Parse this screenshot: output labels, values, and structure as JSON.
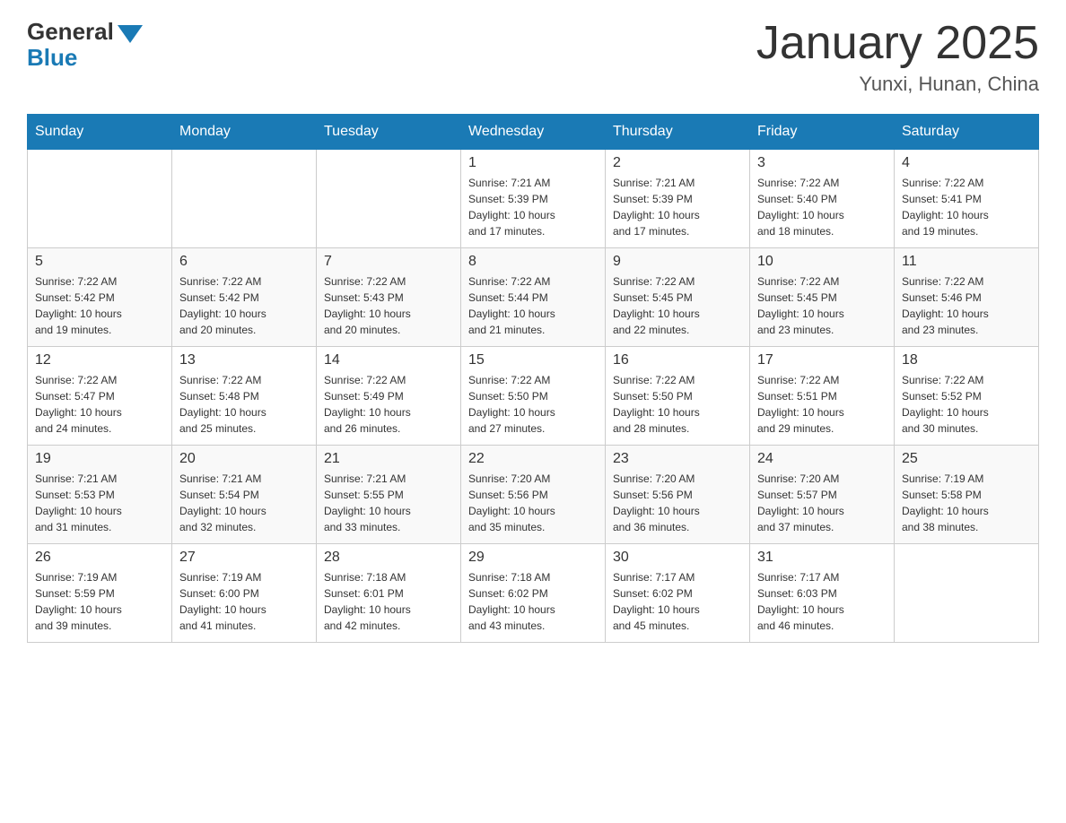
{
  "logo": {
    "general": "General",
    "blue": "Blue"
  },
  "title": "January 2025",
  "subtitle": "Yunxi, Hunan, China",
  "days_of_week": [
    "Sunday",
    "Monday",
    "Tuesday",
    "Wednesday",
    "Thursday",
    "Friday",
    "Saturday"
  ],
  "weeks": [
    {
      "cells": [
        {
          "day": "",
          "info": ""
        },
        {
          "day": "",
          "info": ""
        },
        {
          "day": "",
          "info": ""
        },
        {
          "day": "1",
          "info": "Sunrise: 7:21 AM\nSunset: 5:39 PM\nDaylight: 10 hours\nand 17 minutes."
        },
        {
          "day": "2",
          "info": "Sunrise: 7:21 AM\nSunset: 5:39 PM\nDaylight: 10 hours\nand 17 minutes."
        },
        {
          "day": "3",
          "info": "Sunrise: 7:22 AM\nSunset: 5:40 PM\nDaylight: 10 hours\nand 18 minutes."
        },
        {
          "day": "4",
          "info": "Sunrise: 7:22 AM\nSunset: 5:41 PM\nDaylight: 10 hours\nand 19 minutes."
        }
      ]
    },
    {
      "cells": [
        {
          "day": "5",
          "info": "Sunrise: 7:22 AM\nSunset: 5:42 PM\nDaylight: 10 hours\nand 19 minutes."
        },
        {
          "day": "6",
          "info": "Sunrise: 7:22 AM\nSunset: 5:42 PM\nDaylight: 10 hours\nand 20 minutes."
        },
        {
          "day": "7",
          "info": "Sunrise: 7:22 AM\nSunset: 5:43 PM\nDaylight: 10 hours\nand 20 minutes."
        },
        {
          "day": "8",
          "info": "Sunrise: 7:22 AM\nSunset: 5:44 PM\nDaylight: 10 hours\nand 21 minutes."
        },
        {
          "day": "9",
          "info": "Sunrise: 7:22 AM\nSunset: 5:45 PM\nDaylight: 10 hours\nand 22 minutes."
        },
        {
          "day": "10",
          "info": "Sunrise: 7:22 AM\nSunset: 5:45 PM\nDaylight: 10 hours\nand 23 minutes."
        },
        {
          "day": "11",
          "info": "Sunrise: 7:22 AM\nSunset: 5:46 PM\nDaylight: 10 hours\nand 23 minutes."
        }
      ]
    },
    {
      "cells": [
        {
          "day": "12",
          "info": "Sunrise: 7:22 AM\nSunset: 5:47 PM\nDaylight: 10 hours\nand 24 minutes."
        },
        {
          "day": "13",
          "info": "Sunrise: 7:22 AM\nSunset: 5:48 PM\nDaylight: 10 hours\nand 25 minutes."
        },
        {
          "day": "14",
          "info": "Sunrise: 7:22 AM\nSunset: 5:49 PM\nDaylight: 10 hours\nand 26 minutes."
        },
        {
          "day": "15",
          "info": "Sunrise: 7:22 AM\nSunset: 5:50 PM\nDaylight: 10 hours\nand 27 minutes."
        },
        {
          "day": "16",
          "info": "Sunrise: 7:22 AM\nSunset: 5:50 PM\nDaylight: 10 hours\nand 28 minutes."
        },
        {
          "day": "17",
          "info": "Sunrise: 7:22 AM\nSunset: 5:51 PM\nDaylight: 10 hours\nand 29 minutes."
        },
        {
          "day": "18",
          "info": "Sunrise: 7:22 AM\nSunset: 5:52 PM\nDaylight: 10 hours\nand 30 minutes."
        }
      ]
    },
    {
      "cells": [
        {
          "day": "19",
          "info": "Sunrise: 7:21 AM\nSunset: 5:53 PM\nDaylight: 10 hours\nand 31 minutes."
        },
        {
          "day": "20",
          "info": "Sunrise: 7:21 AM\nSunset: 5:54 PM\nDaylight: 10 hours\nand 32 minutes."
        },
        {
          "day": "21",
          "info": "Sunrise: 7:21 AM\nSunset: 5:55 PM\nDaylight: 10 hours\nand 33 minutes."
        },
        {
          "day": "22",
          "info": "Sunrise: 7:20 AM\nSunset: 5:56 PM\nDaylight: 10 hours\nand 35 minutes."
        },
        {
          "day": "23",
          "info": "Sunrise: 7:20 AM\nSunset: 5:56 PM\nDaylight: 10 hours\nand 36 minutes."
        },
        {
          "day": "24",
          "info": "Sunrise: 7:20 AM\nSunset: 5:57 PM\nDaylight: 10 hours\nand 37 minutes."
        },
        {
          "day": "25",
          "info": "Sunrise: 7:19 AM\nSunset: 5:58 PM\nDaylight: 10 hours\nand 38 minutes."
        }
      ]
    },
    {
      "cells": [
        {
          "day": "26",
          "info": "Sunrise: 7:19 AM\nSunset: 5:59 PM\nDaylight: 10 hours\nand 39 minutes."
        },
        {
          "day": "27",
          "info": "Sunrise: 7:19 AM\nSunset: 6:00 PM\nDaylight: 10 hours\nand 41 minutes."
        },
        {
          "day": "28",
          "info": "Sunrise: 7:18 AM\nSunset: 6:01 PM\nDaylight: 10 hours\nand 42 minutes."
        },
        {
          "day": "29",
          "info": "Sunrise: 7:18 AM\nSunset: 6:02 PM\nDaylight: 10 hours\nand 43 minutes."
        },
        {
          "day": "30",
          "info": "Sunrise: 7:17 AM\nSunset: 6:02 PM\nDaylight: 10 hours\nand 45 minutes."
        },
        {
          "day": "31",
          "info": "Sunrise: 7:17 AM\nSunset: 6:03 PM\nDaylight: 10 hours\nand 46 minutes."
        },
        {
          "day": "",
          "info": ""
        }
      ]
    }
  ]
}
